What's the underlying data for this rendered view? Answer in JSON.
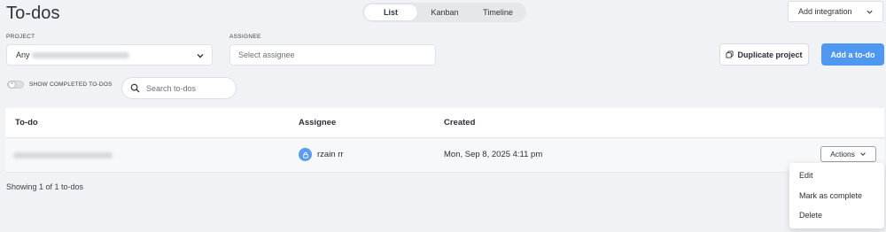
{
  "header": {
    "title": "To-dos",
    "views": [
      "List",
      "Kanban",
      "Timeline"
    ],
    "active_view": "List",
    "integration_label": "Add integration"
  },
  "filters": {
    "project_label": "PROJECT",
    "project_value": "Any",
    "assignee_label": "ASSIGNEE",
    "assignee_placeholder": "Select assignee"
  },
  "buttons": {
    "duplicate": "Duplicate project",
    "add": "Add a to-do"
  },
  "toggle": {
    "label": "SHOW COMPLETED TO-DOS",
    "on": false
  },
  "search": {
    "placeholder": "Search to-dos"
  },
  "table": {
    "columns": [
      "To-do",
      "Assignee",
      "Created"
    ],
    "rows": [
      {
        "assignee": "rzain rr",
        "created": "Mon, Sep 8, 2025 4:11 pm",
        "actions_label": "Actions"
      }
    ]
  },
  "footer": {
    "showing": "Showing 1 of 1 to-dos"
  },
  "actions_menu": {
    "items": [
      "Edit",
      "Mark as complete",
      "Delete"
    ]
  },
  "colors": {
    "primary": "#4e98f2",
    "background": "#f1f2f5"
  }
}
